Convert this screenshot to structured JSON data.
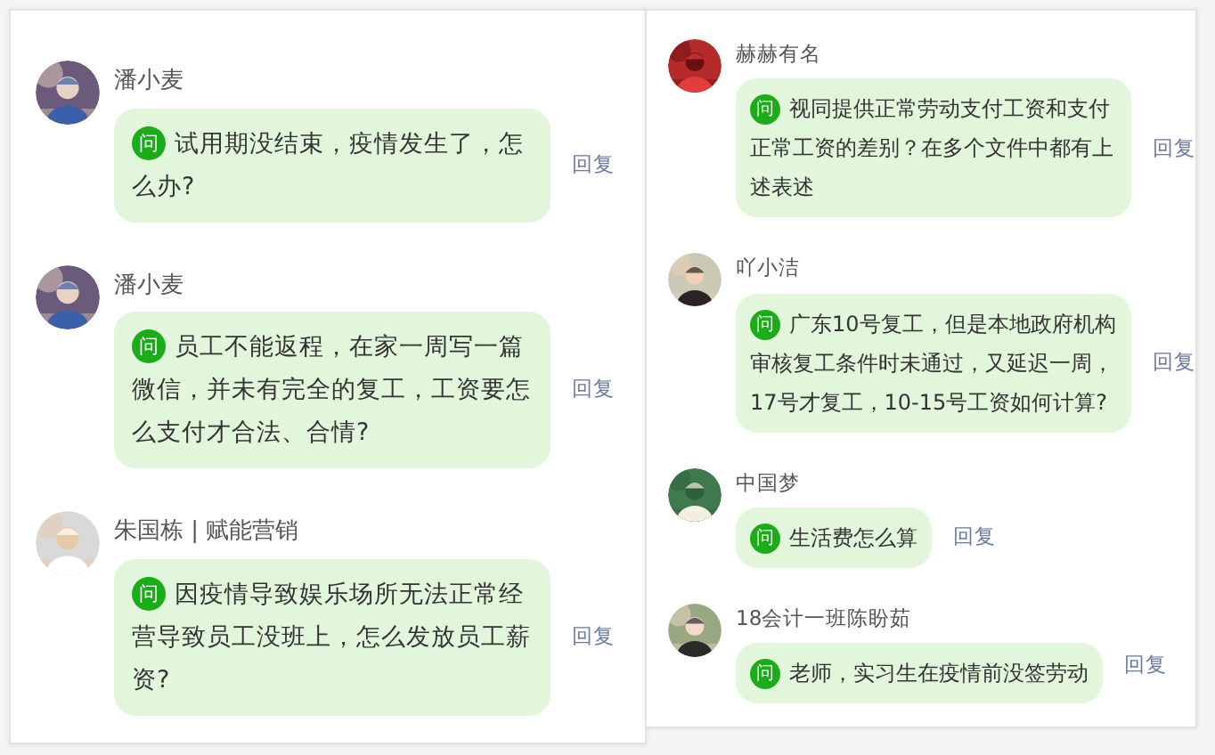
{
  "columns": [
    {
      "comments": [
        {
          "author": "潘小麦",
          "badge": "问",
          "text": "试用期没结束，疫情发生了，怎么办?",
          "reply": "回复"
        },
        {
          "author": "潘小麦",
          "badge": "问",
          "text": "员工不能返程，在家一周写一篇微信，并未有完全的复工，工资要怎么支付才合法、合情?",
          "reply": "回复"
        },
        {
          "author": "朱国栋 | 赋能营销",
          "badge": "问",
          "text": "因疫情导致娱乐场所无法正常经营导致员工没班上，怎么发放员工薪资?",
          "reply": "回复"
        }
      ]
    },
    {
      "comments": [
        {
          "author": "赫赫有名",
          "badge": "问",
          "text": "视同提供正常劳动支付工资和支付正常工资的差别？在多个文件中都有上述表述",
          "reply": "回复"
        },
        {
          "author": "吖小洁",
          "badge": "问",
          "text": "广东10号复工，但是本地政府机构审核复工条件时未通过，又延迟一周，17号才复工，10-15号工资如何计算?",
          "reply": "回复"
        },
        {
          "author": "中国梦",
          "badge": "问",
          "text": "生活费怎么算",
          "reply": "回复"
        },
        {
          "author": "18会计一班陈盼茹",
          "badge": "问",
          "text": "老师，实习生在疫情前没签劳动",
          "reply": "回复"
        }
      ]
    }
  ]
}
